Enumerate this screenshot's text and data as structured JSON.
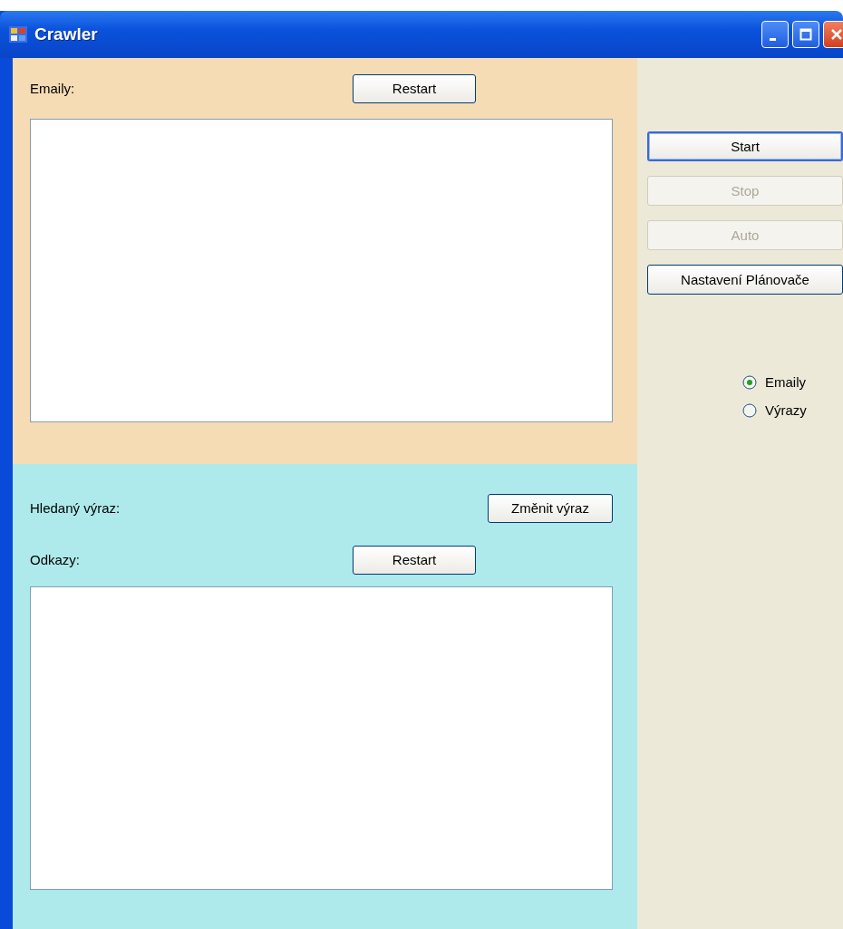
{
  "window": {
    "title": "Crawler"
  },
  "emails_panel": {
    "label": "Emaily:",
    "restart_button": "Restart"
  },
  "search_panel": {
    "query_label": "Hledaný výraz:",
    "change_button": "Změnit výraz",
    "links_label": "Odkazy:",
    "restart_button": "Restart"
  },
  "side_buttons": [
    {
      "label": "Start",
      "disabled": false,
      "focused": true
    },
    {
      "label": "Stop",
      "disabled": true,
      "focused": false
    },
    {
      "label": "Auto",
      "disabled": true,
      "focused": false
    },
    {
      "label": "Nastavení Plánovače",
      "disabled": false,
      "focused": false
    }
  ],
  "mode_radios": [
    {
      "label": "Emaily",
      "selected": true
    },
    {
      "label": "Výrazy",
      "selected": false
    }
  ]
}
